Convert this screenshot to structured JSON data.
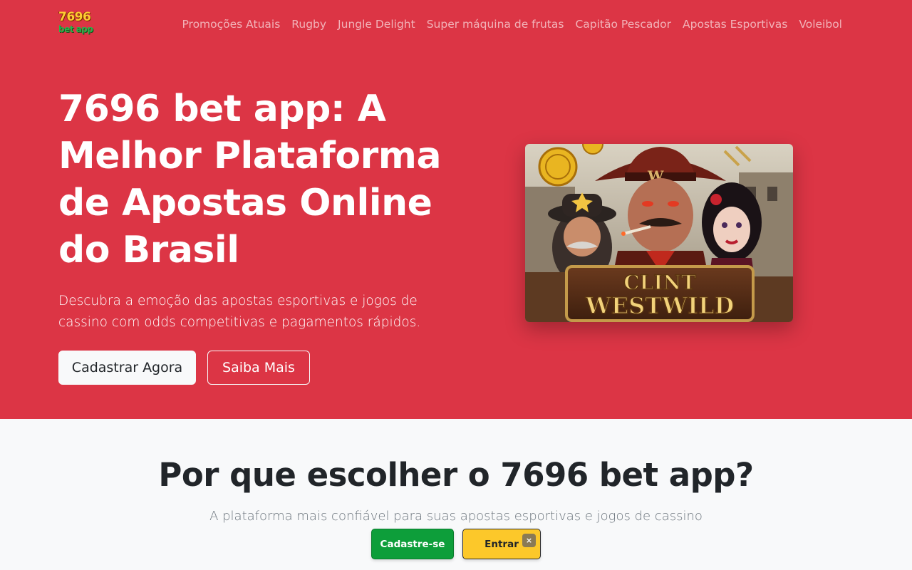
{
  "header": {
    "logo_line1": "7696",
    "logo_line2": "bet app",
    "nav": [
      {
        "label": "Promoções Atuais"
      },
      {
        "label": "Rugby"
      },
      {
        "label": "Jungle Delight"
      },
      {
        "label": "Super máquina de frutas"
      },
      {
        "label": "Capitão Pescador"
      },
      {
        "label": "Apostas Esportivas"
      },
      {
        "label": "Voleibol"
      }
    ]
  },
  "hero": {
    "title": "7696 bet app: A Melhor Plataforma de Apostas Online do Brasil",
    "lead": "Descubra a emoção das apostas esportivas e jogos de cassino com odds competitivas e pagamentos rápidos.",
    "primary_button": "Cadastrar Agora",
    "secondary_button": "Saiba Mais",
    "game_line1": "CLINT",
    "game_line2": "WESTWILD"
  },
  "why": {
    "title": "Por que escolher o 7696 bet app?",
    "subtitle": "A plataforma mais confiável para suas apostas esportivas e jogos de cassino"
  },
  "floating_cta": {
    "register_label": "Cadastre-se",
    "login_label": "Entrar",
    "close_label": "×"
  },
  "colors": {
    "hero_bg": "#dc3545",
    "register_green": "#0d9e3a",
    "login_yellow": "#fcc82a"
  }
}
